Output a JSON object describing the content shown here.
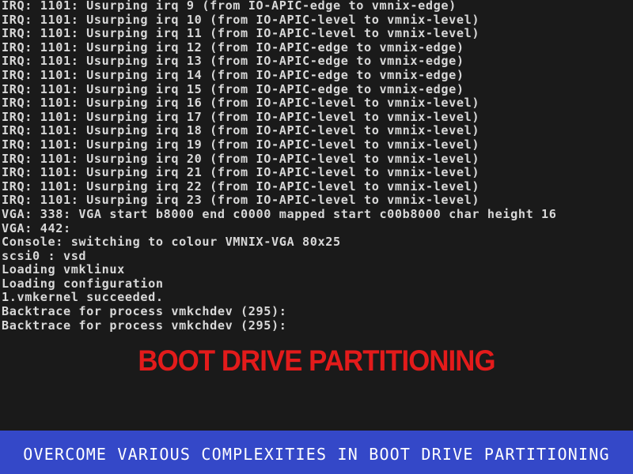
{
  "console": {
    "lines": [
      "IRQ: 1101: Usurping irq 9 (from IO-APIC-edge to vmnix-edge)",
      "IRQ: 1101: Usurping irq 10 (from IO-APIC-level to vmnix-level)",
      "IRQ: 1101: Usurping irq 11 (from IO-APIC-level to vmnix-level)",
      "IRQ: 1101: Usurping irq 12 (from IO-APIC-edge to vmnix-edge)",
      "IRQ: 1101: Usurping irq 13 (from IO-APIC-edge to vmnix-edge)",
      "IRQ: 1101: Usurping irq 14 (from IO-APIC-edge to vmnix-edge)",
      "IRQ: 1101: Usurping irq 15 (from IO-APIC-edge to vmnix-edge)",
      "IRQ: 1101: Usurping irq 16 (from IO-APIC-level to vmnix-level)",
      "IRQ: 1101: Usurping irq 17 (from IO-APIC-level to vmnix-level)",
      "IRQ: 1101: Usurping irq 18 (from IO-APIC-level to vmnix-level)",
      "IRQ: 1101: Usurping irq 19 (from IO-APIC-level to vmnix-level)",
      "IRQ: 1101: Usurping irq 20 (from IO-APIC-level to vmnix-level)",
      "IRQ: 1101: Usurping irq 21 (from IO-APIC-level to vmnix-level)",
      "IRQ: 1101: Usurping irq 22 (from IO-APIC-level to vmnix-level)",
      "IRQ: 1101: Usurping irq 23 (from IO-APIC-level to vmnix-level)",
      "VGA: 338: VGA start b8000 end c0000 mapped start c00b8000 char height 16",
      "VGA: 442:",
      "Console: switching to colour VMNIX-VGA 80x25",
      "scsi0 : vsd",
      "Loading vmklinux",
      "Loading configuration",
      "1.vmkernel succeeded.",
      "Backtrace for process vmkchdev (295):",
      "Backtrace for process vmkchdev (295):"
    ]
  },
  "headline": "BOOT DRIVE PARTITIONING",
  "banner": {
    "text": "OVERCOME VARIOUS COMPLEXITIES IN BOOT DRIVE PARTITIONING"
  },
  "colors": {
    "background": "#1a1a1a",
    "console_text": "#d8d8d8",
    "headline": "#e31b1b",
    "banner_background": "#3448c8",
    "banner_text": "#ffffff"
  }
}
